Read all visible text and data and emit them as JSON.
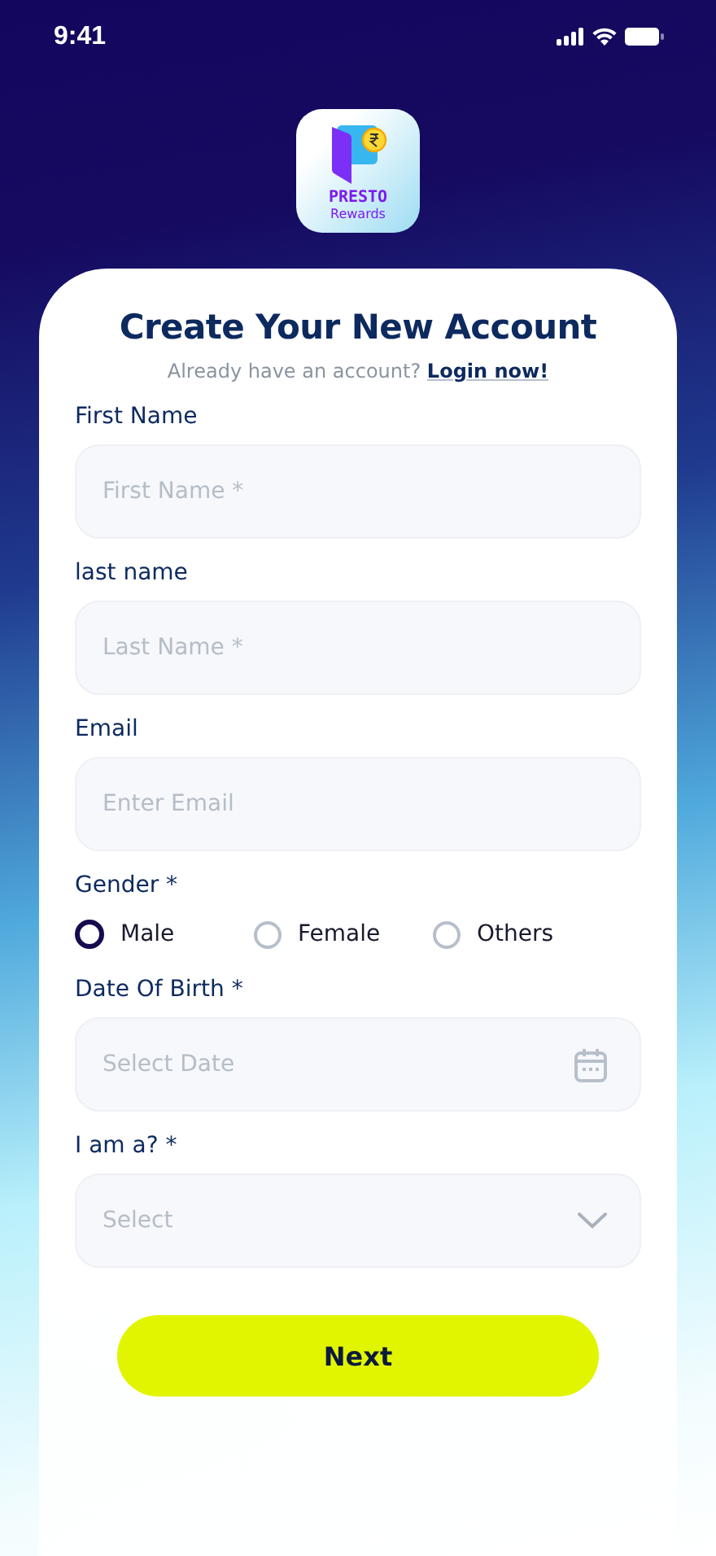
{
  "status_bar": {
    "time": "9:41"
  },
  "logo": {
    "brand": "PRESTO",
    "subtitle": "Rewards"
  },
  "title": "Create Your New Account",
  "login_prompt": {
    "text": "Already have an account?",
    "link": "Login now!"
  },
  "fields": [
    {
      "kind": "text",
      "label": "First Name",
      "placeholder": "First Name *"
    },
    {
      "kind": "text",
      "label": "last name",
      "placeholder": "Last Name *"
    },
    {
      "kind": "text",
      "label": "Email",
      "placeholder": "Enter Email"
    },
    {
      "kind": "radio",
      "label": "Gender *",
      "options": [
        {
          "label": "Male",
          "selected": true
        },
        {
          "label": "Female",
          "selected": false
        },
        {
          "label": "Others",
          "selected": false
        }
      ]
    },
    {
      "kind": "date",
      "label": "Date Of Birth *",
      "placeholder": "Select Date"
    },
    {
      "kind": "select",
      "label": "I am a? *",
      "placeholder": "Select"
    }
  ],
  "submit_button": "Next"
}
